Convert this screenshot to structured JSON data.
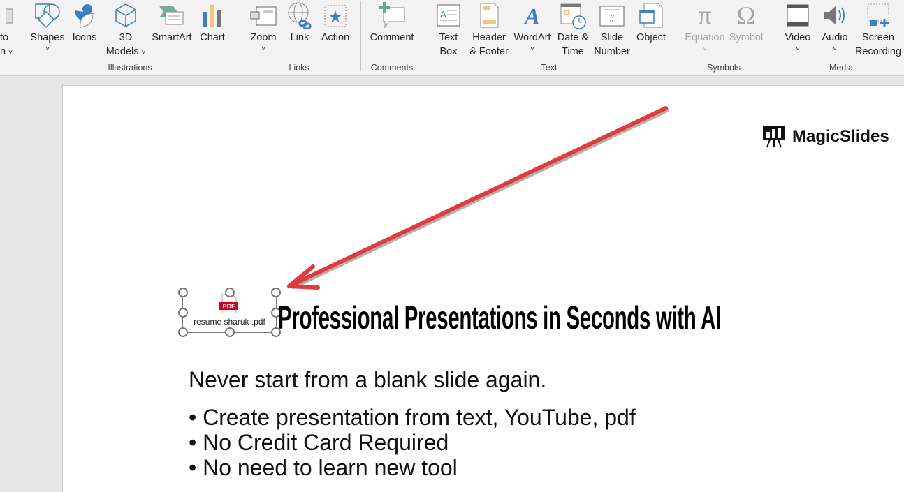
{
  "ribbon": {
    "partial": {
      "line1": "to",
      "line2": "n"
    },
    "items": [
      {
        "label1": "Shapes",
        "chev": true
      },
      {
        "label1": "Icons"
      },
      {
        "label1": "3D",
        "label2": "Models"
      },
      {
        "label1": "SmartArt"
      },
      {
        "label1": "Chart"
      },
      {
        "label1": "Zoom"
      },
      {
        "label1": "Link"
      },
      {
        "label1": "Action"
      },
      {
        "label1": "Comment"
      },
      {
        "label1": "Text",
        "label2": "Box"
      },
      {
        "label1": "Header",
        "label2": "& Footer"
      },
      {
        "label1": "WordArt"
      },
      {
        "label1": "Date &",
        "label2": "Time"
      },
      {
        "label1": "Slide",
        "label2": "Number"
      },
      {
        "label1": "Object"
      },
      {
        "label1": "Equation"
      },
      {
        "label1": "Symbol"
      },
      {
        "label1": "Video"
      },
      {
        "label1": "Audio"
      },
      {
        "label1": "Screen",
        "label2": "Recording"
      }
    ],
    "groups": [
      "Illustrations",
      "Links",
      "Comments",
      "Text",
      "Symbols",
      "Media"
    ]
  },
  "slide": {
    "logo": "MagicSlides",
    "attachment": {
      "badge": "PDF",
      "filename": "resume sharuk .pdf"
    },
    "title": "Professional Presentations in Seconds with AI",
    "subtitle": "Never start from a blank slide again.",
    "bullets": [
      "• Create presentation from text, YouTube, pdf",
      "• No Credit Card Required",
      "• No need to learn new tool"
    ]
  },
  "colors": {
    "arrow": "#e03c3c",
    "icon_blue": "#3f7fc1",
    "pdf_red": "#d0021b"
  }
}
